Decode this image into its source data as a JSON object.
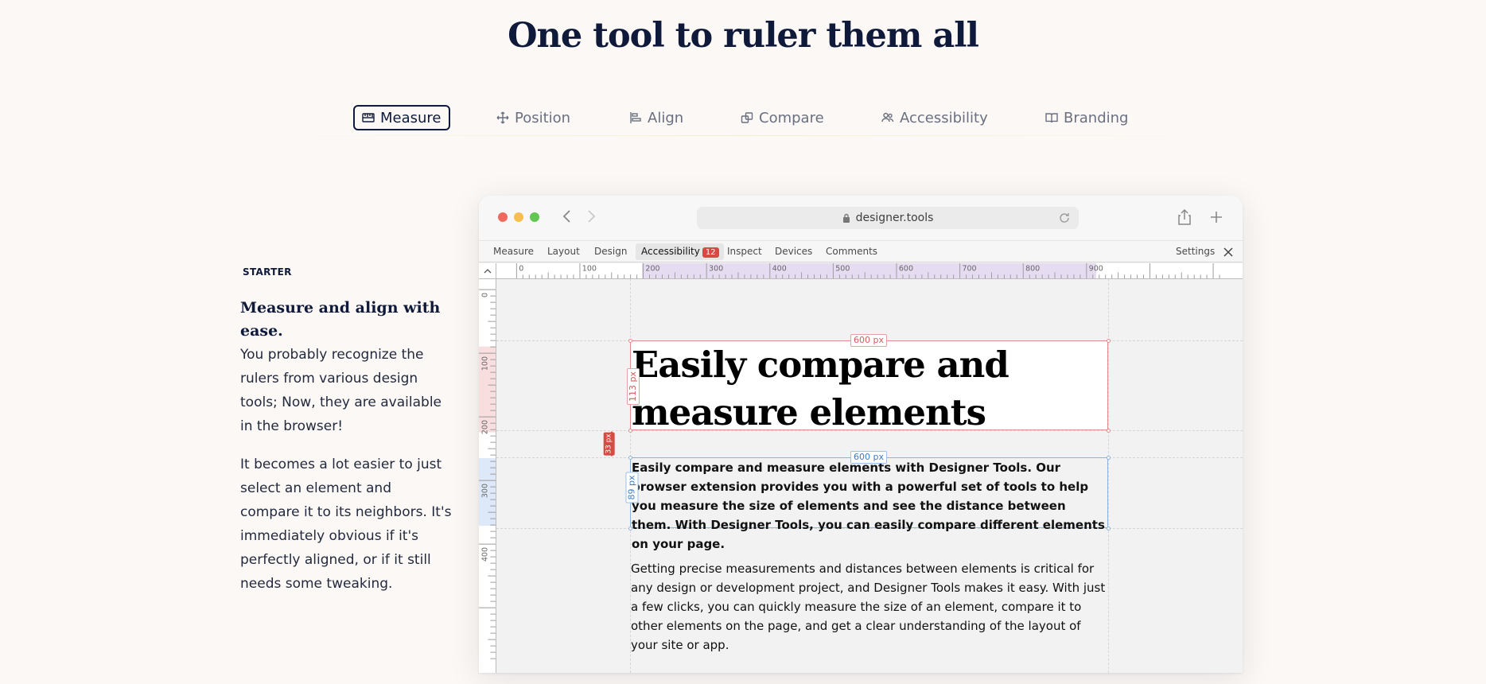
{
  "headline": "One tool to ruler them all",
  "feature_tabs": [
    {
      "label": "Measure",
      "icon": "ruler-icon",
      "active": true
    },
    {
      "label": "Position",
      "icon": "move-icon",
      "active": false
    },
    {
      "label": "Align",
      "icon": "align-icon",
      "active": false
    },
    {
      "label": "Compare",
      "icon": "compare-icon",
      "active": false
    },
    {
      "label": "Accessibility",
      "icon": "people-icon",
      "active": false
    },
    {
      "label": "Branding",
      "icon": "book-icon",
      "active": false
    }
  ],
  "side": {
    "eyebrow": "STARTER",
    "title": "Measure and align with ease.",
    "paragraph_1": "You probably recognize the rulers from various design tools; Now, they are available in the browser!",
    "paragraph_2": "It becomes a lot easier to just select an element and compare it to its neighbors. It's immediately obvious if it's perfectly aligned, or if it still needs some tweaking."
  },
  "browser": {
    "url": "designer.tools",
    "toolbar": {
      "items": [
        "Measure",
        "Layout",
        "Design",
        "Accessibility",
        "Inspect",
        "Devices",
        "Comments"
      ],
      "accessibility_badge": "12",
      "settings": "Settings"
    },
    "ruler_h_labels": [
      "0",
      "100",
      "200",
      "300",
      "400",
      "500",
      "600",
      "700",
      "800",
      "900"
    ],
    "ruler_v_labels": [
      "0",
      "100",
      "200",
      "300",
      "400"
    ],
    "canvas": {
      "heading": "Easily compare and\nmeasure elements",
      "heading_width_tag": "600 px",
      "heading_height_tag": "113 px",
      "gap_tag": "33 px",
      "para_width_tag": "600 px",
      "para_height_tag": "89 px",
      "paragraph_1": "Easily compare and measure elements with Designer Tools. Our browser extension provides you with a powerful set of tools to help you measure the size of elements and see the distance between them. With Designer Tools, you can easily compare different elements on your page.",
      "paragraph_2": "Getting precise measurements and distances between elements is critical for any design or development project, and Designer Tools makes it easy. With just a few clicks, you can quickly measure the size of an element, compare it to other elements on the page, and get a clear understanding of the layout of your site or app."
    }
  },
  "colors": {
    "page_bg": "#fbf8f5",
    "ink": "#0f1a3a",
    "measure_red": "#d84a44",
    "measure_blue": "#3a7cc4"
  }
}
